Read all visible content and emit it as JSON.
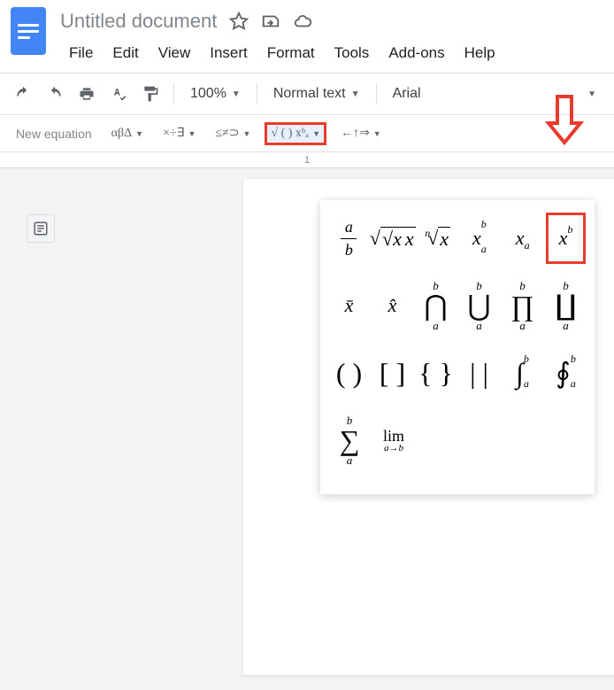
{
  "doc": {
    "title": "Untitled document"
  },
  "menu": {
    "file": "File",
    "edit": "Edit",
    "view": "View",
    "insert": "Insert",
    "format": "Format",
    "tools": "Tools",
    "addons": "Add-ons",
    "help": "Help"
  },
  "toolbar": {
    "zoom": "100%",
    "style": "Normal text",
    "font": "Arial"
  },
  "eqbar": {
    "new": "New equation",
    "greek": "αβΔ",
    "ops": "×÷∃",
    "rel": "≤≠⊃",
    "math": "√ ( ) xᵇₐ",
    "arrows": "←↑⇒"
  },
  "ruler": {
    "mark": "1"
  },
  "mathpanel": {
    "r1": {
      "frac_a": "a",
      "frac_b": "b",
      "sqrt": "√x",
      "nroot_n": "n",
      "nroot_x": "x",
      "xab_x": "x",
      "xab_a": "a",
      "xab_b": "b",
      "xa_x": "x",
      "xa_a": "a",
      "xb_x": "x",
      "xb_b": "b"
    },
    "r2": {
      "xbar": "x̄",
      "xhat": "x̂",
      "cap": "⋂",
      "cup": "⋃",
      "prod": "∏",
      "coprod": "∐",
      "lim_a": "a",
      "lim_b": "b"
    },
    "r3": {
      "paren": "( )",
      "brack": "[ ]",
      "brace": "{ }",
      "vbar": "| |",
      "int": "∫",
      "oint": "∮",
      "lim_a": "a",
      "lim_b": "b"
    },
    "r4": {
      "sum": "∑",
      "lim": "lim",
      "lim_sub": "a→b",
      "lim_a": "a",
      "lim_b": "b"
    }
  }
}
